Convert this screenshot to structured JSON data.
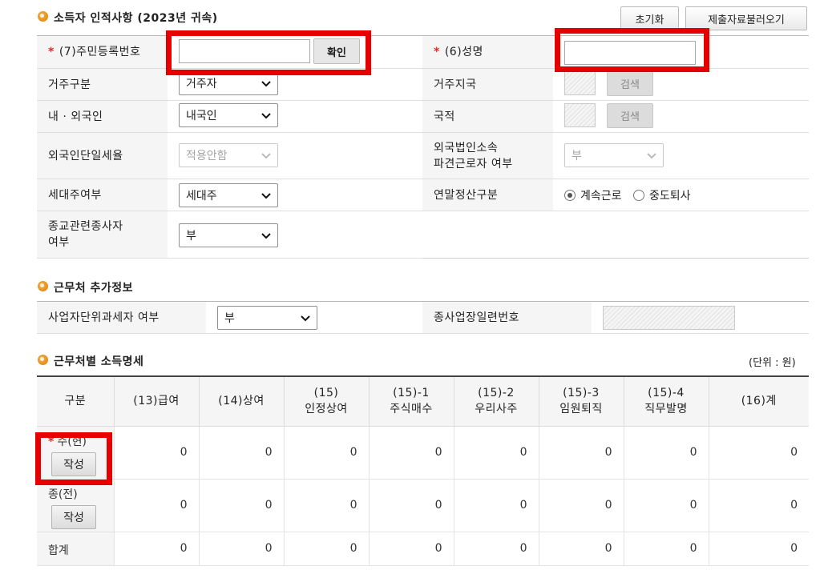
{
  "section1": {
    "title": "소득자 인적사항 (2023년 귀속)",
    "reset_button": "초기화",
    "load_button": "제출자료불러오기",
    "rows": {
      "rrn_label": "(7)주민등록번호",
      "rrn_required": "*",
      "rrn_value": "",
      "confirm_button": "확인",
      "name_label": "(6)성명",
      "name_required": "*",
      "name_value": "",
      "residency_label": "거주구분",
      "residency_value": "거주자",
      "residency_region_label": "거주지국",
      "search_button_1": "검색",
      "nationality_type_label": "내 · 외국인",
      "nationality_type_value": "내국인",
      "nationality_label": "국적",
      "search_button_2": "검색",
      "flat_tax_label": "외국인단일세율",
      "flat_tax_value": "적용안함",
      "dispatched_label_1": "외국법인소속",
      "dispatched_label_2": "파견근로자 여부",
      "dispatched_value": "부",
      "household_label": "세대주여부",
      "household_value": "세대주",
      "settlement_label": "연말정산구분",
      "settlement_opt1": "계속근로",
      "settlement_opt2": "중도퇴사",
      "religious_label_1": "종교관련종사자",
      "religious_label_2": "여부",
      "religious_value": "부"
    }
  },
  "section2": {
    "title": "근무처 추가정보",
    "unit_tax_label": "사업자단위과세자 여부",
    "unit_tax_value": "부",
    "branch_label": "종사업장일련번호"
  },
  "section3": {
    "title": "근무처별 소득명세",
    "unit": "(단위 : 원)",
    "headers": [
      [
        "구분",
        ""
      ],
      [
        "(13)급여",
        ""
      ],
      [
        "(14)상여",
        ""
      ],
      [
        "(15)",
        "인정상여"
      ],
      [
        "(15)-1",
        "주식매수"
      ],
      [
        "(15)-2",
        "우리사주"
      ],
      [
        "(15)-3",
        "임원퇴직"
      ],
      [
        "(15)-4",
        "직무발명"
      ],
      [
        "(16)계",
        ""
      ]
    ],
    "rows": [
      {
        "label": "주(현)",
        "required": "*",
        "button": "작성",
        "values": [
          "0",
          "0",
          "0",
          "0",
          "0",
          "0",
          "0",
          "0"
        ]
      },
      {
        "label": "종(전)",
        "required": "",
        "button": "작성",
        "values": [
          "0",
          "0",
          "0",
          "0",
          "0",
          "0",
          "0",
          "0"
        ]
      },
      {
        "label": "합계",
        "required": "",
        "button": "",
        "values": [
          "0",
          "0",
          "0",
          "0",
          "0",
          "0",
          "0",
          "0"
        ]
      }
    ]
  }
}
